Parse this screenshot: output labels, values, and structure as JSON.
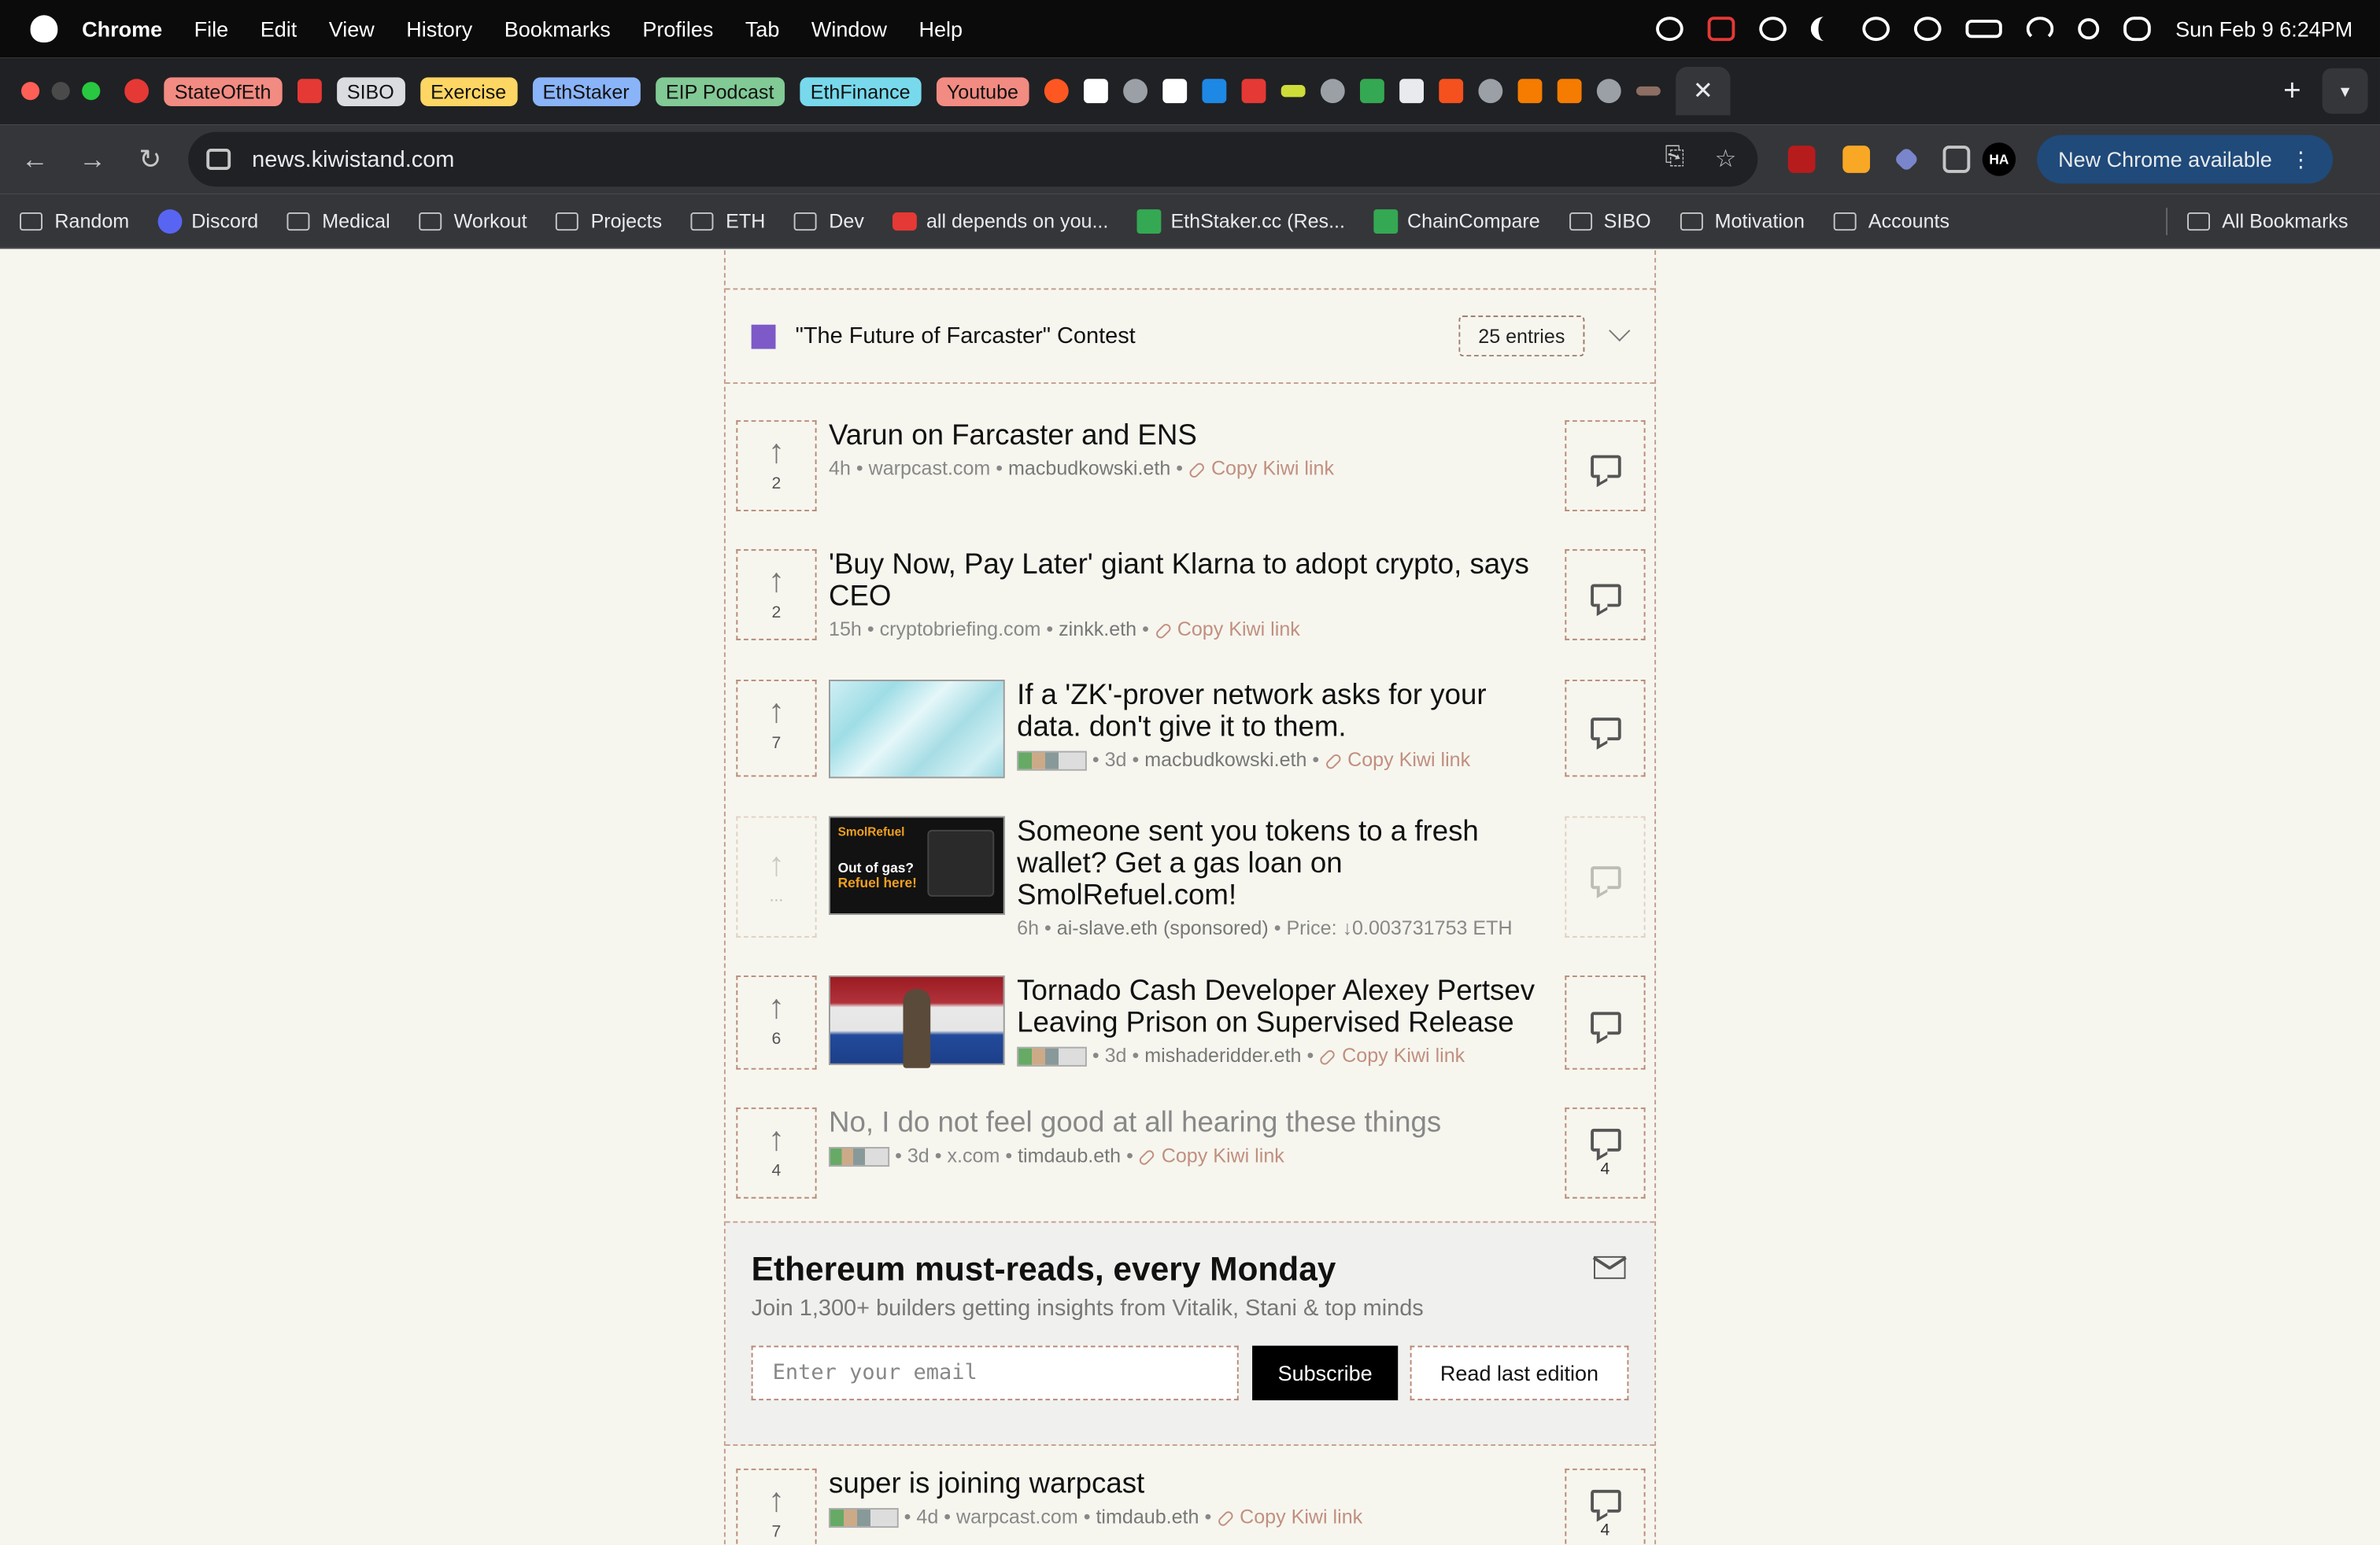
{
  "menubar": {
    "app": "Chrome",
    "items": [
      "File",
      "Edit",
      "View",
      "History",
      "Bookmarks",
      "Profiles",
      "Tab",
      "Window",
      "Help"
    ],
    "clock": "Sun Feb 9  6:24PM"
  },
  "tabs": {
    "chips": [
      {
        "label": "StateOfEth",
        "color": "#f28b82"
      },
      {
        "label": "SIBO",
        "color": "#dadce0"
      },
      {
        "label": "Exercise",
        "color": "#fdd663"
      },
      {
        "label": "EthStaker",
        "color": "#8ab4f8"
      },
      {
        "label": "EIP Podcast",
        "color": "#81c995"
      },
      {
        "label": "EthFinance",
        "color": "#78d9ec"
      },
      {
        "label": "Youtube",
        "color": "#f28b82"
      }
    ],
    "close_glyph": "✕",
    "new_tab_glyph": "+"
  },
  "toolbar": {
    "url": "news.kiwistand.com",
    "avatar_initials": "HA",
    "update_label": "New Chrome available"
  },
  "bookmarks": {
    "items": [
      {
        "label": "Random",
        "type": "folder"
      },
      {
        "label": "Discord",
        "type": "site"
      },
      {
        "label": "Medical",
        "type": "folder"
      },
      {
        "label": "Workout",
        "type": "folder"
      },
      {
        "label": "Projects",
        "type": "folder"
      },
      {
        "label": "ETH",
        "type": "folder"
      },
      {
        "label": "Dev",
        "type": "folder"
      },
      {
        "label": "all depends on you...",
        "type": "site"
      },
      {
        "label": "EthStaker.cc (Res...",
        "type": "site"
      },
      {
        "label": "ChainCompare",
        "type": "site"
      },
      {
        "label": "SIBO",
        "type": "folder"
      },
      {
        "label": "Motivation",
        "type": "folder"
      },
      {
        "label": "Accounts",
        "type": "folder"
      }
    ],
    "all_label": "All Bookmarks"
  },
  "contest": {
    "title": "\"The Future of Farcaster\" Contest",
    "entries": "25 entries"
  },
  "stories": [
    {
      "title": "Varun on Farcaster and ENS",
      "votes": "2",
      "age": "4h",
      "domain": "warpcast.com",
      "author": "macbudkowski.eth",
      "copy": "Copy Kiwi link",
      "comments": ""
    },
    {
      "title": "'Buy Now, Pay Later' giant Klarna to adopt crypto, says CEO",
      "votes": "2",
      "age": "15h",
      "domain": "cryptobriefing.com",
      "author": "zinkk.eth",
      "copy": "Copy Kiwi link",
      "comments": ""
    },
    {
      "title": "If a 'ZK'-prover network asks for your data. don't give it to them.",
      "votes": "7",
      "age": "3d",
      "author": "macbudkowski.eth",
      "copy": "Copy Kiwi link",
      "comments": ""
    },
    {
      "title": "Someone sent you tokens to a fresh wallet? Get a gas loan on SmolRefuel.com!",
      "votes": "...",
      "age": "6h",
      "author": "ai-slave.eth (sponsored)",
      "price": "Price: ↓0.003731753 ETH",
      "thumb_brand": "SmolRefuel",
      "thumb_line1": "Out of gas?",
      "thumb_line2": "Refuel here!",
      "comments": ""
    },
    {
      "title": "Tornado Cash Developer Alexey Pertsev Leaving Prison on Supervised Release",
      "votes": "6",
      "age": "3d",
      "author": "mishaderidder.eth",
      "copy": "Copy Kiwi link",
      "comments": ""
    },
    {
      "title": "No, I do not feel good at all hearing these things",
      "votes": "4",
      "age": "3d",
      "domain": "x.com",
      "author": "timdaub.eth",
      "copy": "Copy Kiwi link",
      "comments": "4"
    },
    {
      "title": "super is joining warpcast",
      "votes": "7",
      "age": "4d",
      "domain": "warpcast.com",
      "author": "timdaub.eth",
      "copy": "Copy Kiwi link",
      "comments": "4"
    }
  ],
  "newsletter": {
    "title": "Ethereum must-reads, every Monday",
    "subtitle": "Join 1,300+ builders getting insights from Vitalik, Stani & top minds",
    "email_placeholder": "Enter your email",
    "subscribe_label": "Subscribe",
    "read_label": "Read last edition"
  },
  "colors": {
    "accent": "#7d5ac7",
    "dashed_border": "#c49c8a",
    "page_bg": "#f6f6ef",
    "kiwi_link": "#c18f7f"
  }
}
